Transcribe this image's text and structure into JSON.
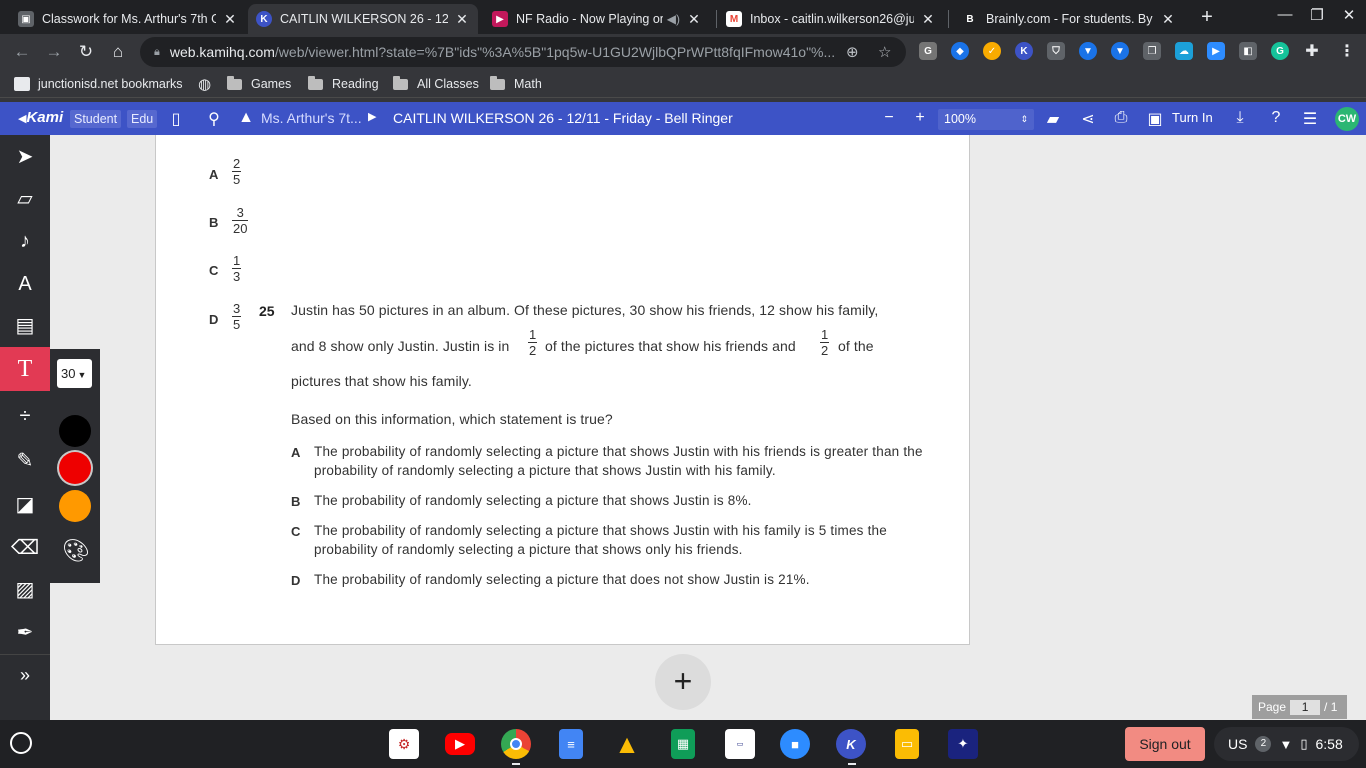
{
  "tabs": [
    {
      "title": "Classwork for Ms. Arthur's 7th G",
      "favicon_color": "#5f6368",
      "favicon_char": "▣",
      "active": false
    },
    {
      "title": "CAITLIN WILKERSON 26 - 12/11",
      "favicon_color": "#3d53c6",
      "favicon_char": "K",
      "active": true
    },
    {
      "title": "NF Radio - Now Playing on",
      "favicon_color": "#c2185b",
      "favicon_char": "▶",
      "active": false
    },
    {
      "title": "Inbox - caitlin.wilkerson26@jun",
      "favicon_color": "#ea4335",
      "favicon_char": "M",
      "active": false
    },
    {
      "title": "Brainly.com - For students. By s",
      "favicon_color": "#202124",
      "favicon_char": "B",
      "active": false
    }
  ],
  "window_controls": {
    "minimize": "—",
    "maximize": "❐",
    "close": "✕"
  },
  "omnibox": {
    "host": "web.kamihq.com",
    "path": "/web/viewer.html?state=%7B\"ids\"%3A%5B\"1pq5w-U1GU2WjlbQPrWPtt8fqIFmow41o\"%..."
  },
  "bookmarks": [
    {
      "label": "junctionisd.net bookmarks",
      "type": "icon"
    },
    {
      "label": "",
      "type": "globe"
    },
    {
      "label": "Games",
      "type": "folder"
    },
    {
      "label": "Reading",
      "type": "folder"
    },
    {
      "label": "All Classes",
      "type": "folder"
    },
    {
      "label": "Math",
      "type": "folder"
    }
  ],
  "kami": {
    "logo": "Kami",
    "chip_student": "Student",
    "chip_edu": "Edu",
    "breadcrumb_class": "Ms. Arthur's 7t...",
    "doc_title": "CAITLIN WILKERSON 26 - 12/11 - Friday - Bell Ringer",
    "zoom": "100%",
    "turn_in": "Turn In",
    "avatar": "CW"
  },
  "text_tool": {
    "font_size": "30",
    "colors": [
      "#000000",
      "#ee0000",
      "#ff9900"
    ]
  },
  "document": {
    "prev_options": [
      {
        "letter": "A",
        "num": "2",
        "den": "5"
      },
      {
        "letter": "B",
        "num": "3",
        "den": "20"
      },
      {
        "letter": "C",
        "num": "1",
        "den": "3"
      },
      {
        "letter": "D",
        "num": "3",
        "den": "5"
      }
    ],
    "question_number": "25",
    "q_line1": "Justin has 50 pictures in an album. Of these pictures, 30 show his friends, 12 show his family,",
    "q_line2a": "and 8 show only Justin. Justin is in",
    "q_line2b": "of the pictures that show his friends and",
    "q_line2c": "of the",
    "q_frac": {
      "num": "1",
      "den": "2"
    },
    "q_line3": "pictures that show his family.",
    "prompt": "Based on this information, which statement is true?",
    "answers": [
      {
        "letter": "A",
        "text": "The probability of randomly selecting a picture that shows Justin with his friends is greater than the probability of randomly selecting a picture that shows Justin with his family."
      },
      {
        "letter": "B",
        "text": "The probability of randomly selecting a picture that shows Justin is 8%."
      },
      {
        "letter": "C",
        "text": "The probability of randomly selecting a picture that shows Justin with his family is 5 times the probability of randomly selecting a picture that shows only his friends."
      },
      {
        "letter": "D",
        "text": "The probability of randomly selecting a picture that does not show Justin is 21%."
      }
    ]
  },
  "page_indicator": {
    "label": "Page",
    "current": "1",
    "total": "/ 1"
  },
  "shelf": {
    "sign_out": "Sign out",
    "locale": "US",
    "notifications": "2",
    "time": "6:58"
  }
}
